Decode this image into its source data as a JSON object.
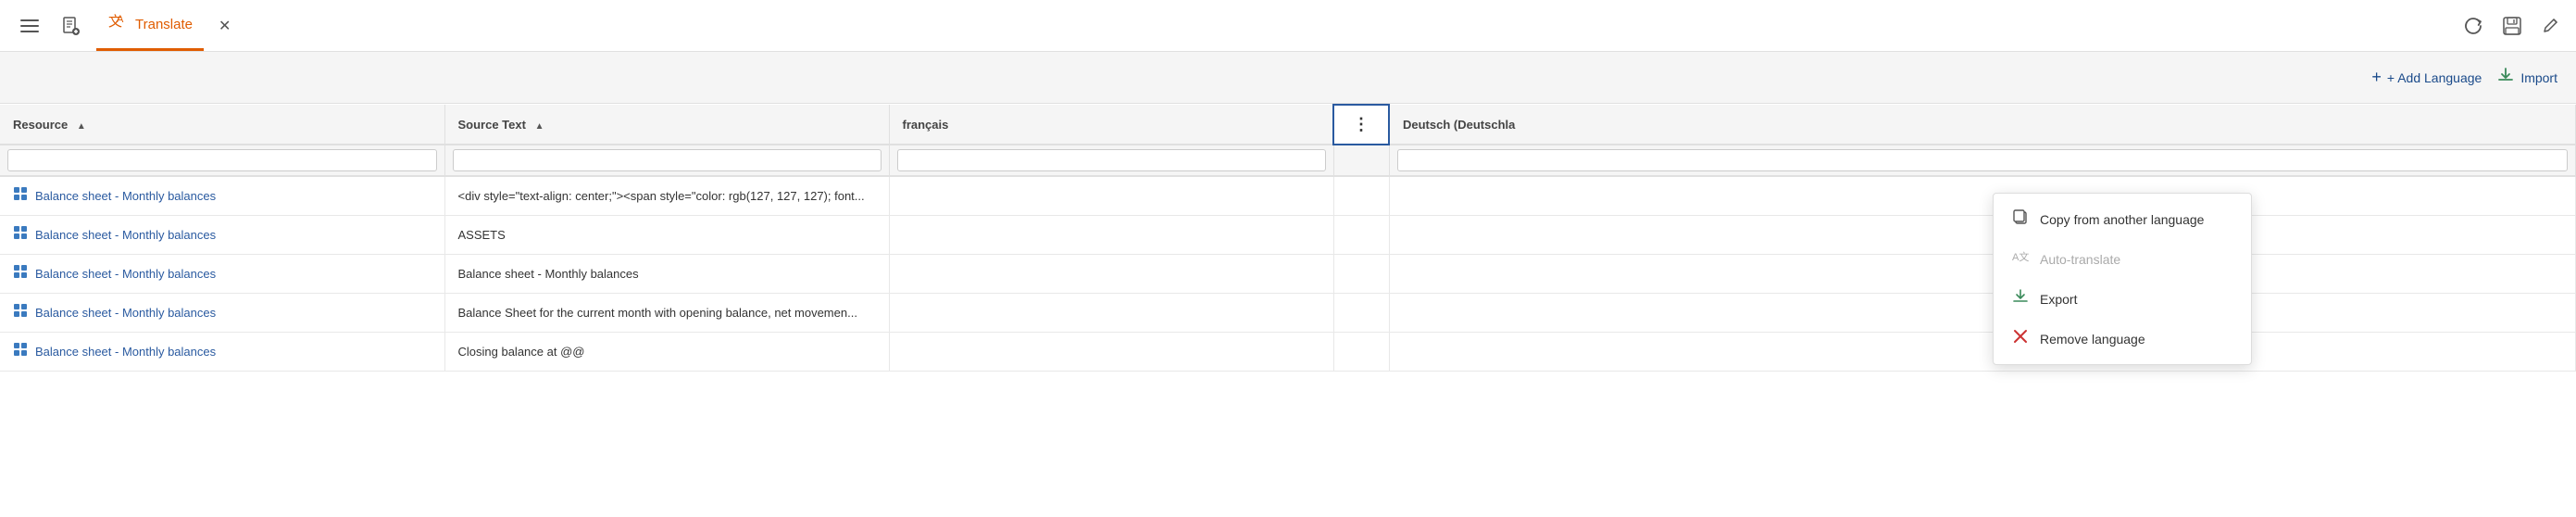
{
  "toolbar": {
    "hamburger_label": "☰",
    "new_icon": "📄",
    "translate_icon": "文A",
    "translate_label": "Translate",
    "close_icon": "✕",
    "refresh_icon": "↻",
    "save_icon": "💾",
    "edit_icon": "✏"
  },
  "action_bar": {
    "add_language_label": "+ Add Language",
    "import_label": "Import"
  },
  "table": {
    "headers": [
      {
        "key": "resource",
        "label": "Resource",
        "sortable": true
      },
      {
        "key": "source_text",
        "label": "Source Text",
        "sortable": true
      },
      {
        "key": "francais",
        "label": "français",
        "sortable": false
      },
      {
        "key": "actions",
        "label": "⋮",
        "sortable": false
      },
      {
        "key": "deutsch",
        "label": "Deutsch (Deutschla",
        "sortable": false
      }
    ],
    "rows": [
      {
        "resource": "Balance sheet - Monthly balances",
        "source_text": "<div style=\"text-align: center;\"><span style=\"color: rgb(127, 127, 127); font...",
        "francais": "",
        "deutsch": ""
      },
      {
        "resource": "Balance sheet - Monthly balances",
        "source_text": "ASSETS",
        "francais": "",
        "deutsch": ""
      },
      {
        "resource": "Balance sheet - Monthly balances",
        "source_text": "Balance sheet - Monthly balances",
        "francais": "",
        "deutsch": ""
      },
      {
        "resource": "Balance sheet - Monthly balances",
        "source_text": "Balance Sheet for the current month with opening balance, net movemen...",
        "francais": "",
        "deutsch": ""
      },
      {
        "resource": "Balance sheet - Monthly balances",
        "source_text": "Closing balance at @@",
        "francais": "",
        "deutsch": ""
      }
    ]
  },
  "dropdown": {
    "copy_label": "Copy from another language",
    "auto_label": "Auto-translate",
    "export_label": "Export",
    "remove_label": "Remove language"
  }
}
